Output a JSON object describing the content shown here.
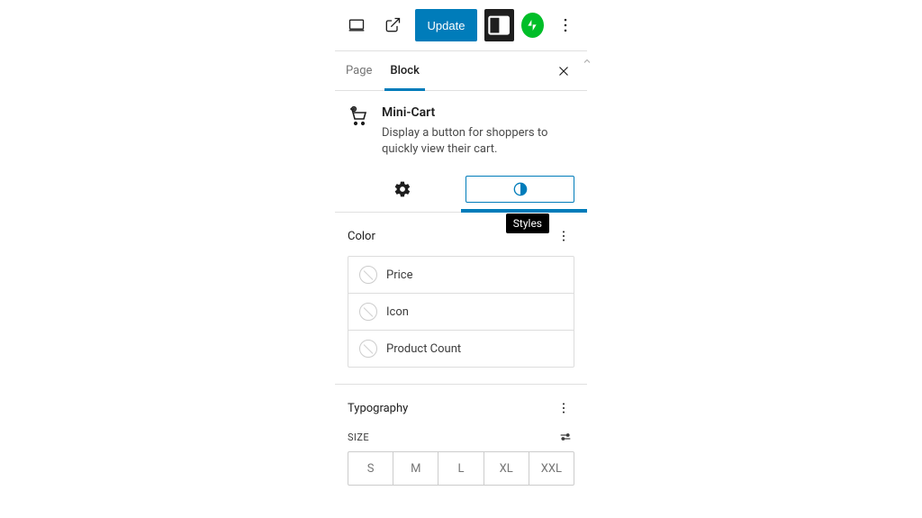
{
  "toolbar": {
    "update_label": "Update"
  },
  "tabs": {
    "page_label": "Page",
    "block_label": "Block",
    "active": "block"
  },
  "block": {
    "title": "Mini-Cart",
    "description": "Display a button for shoppers to quickly view their cart."
  },
  "mode_tooltip": "Styles",
  "color_section": {
    "title": "Color",
    "items": [
      {
        "label": "Price"
      },
      {
        "label": "Icon"
      },
      {
        "label": "Product Count"
      }
    ]
  },
  "typography_section": {
    "title": "Typography",
    "size_label": "Size",
    "sizes": [
      "S",
      "M",
      "L",
      "XL",
      "XXL"
    ]
  }
}
